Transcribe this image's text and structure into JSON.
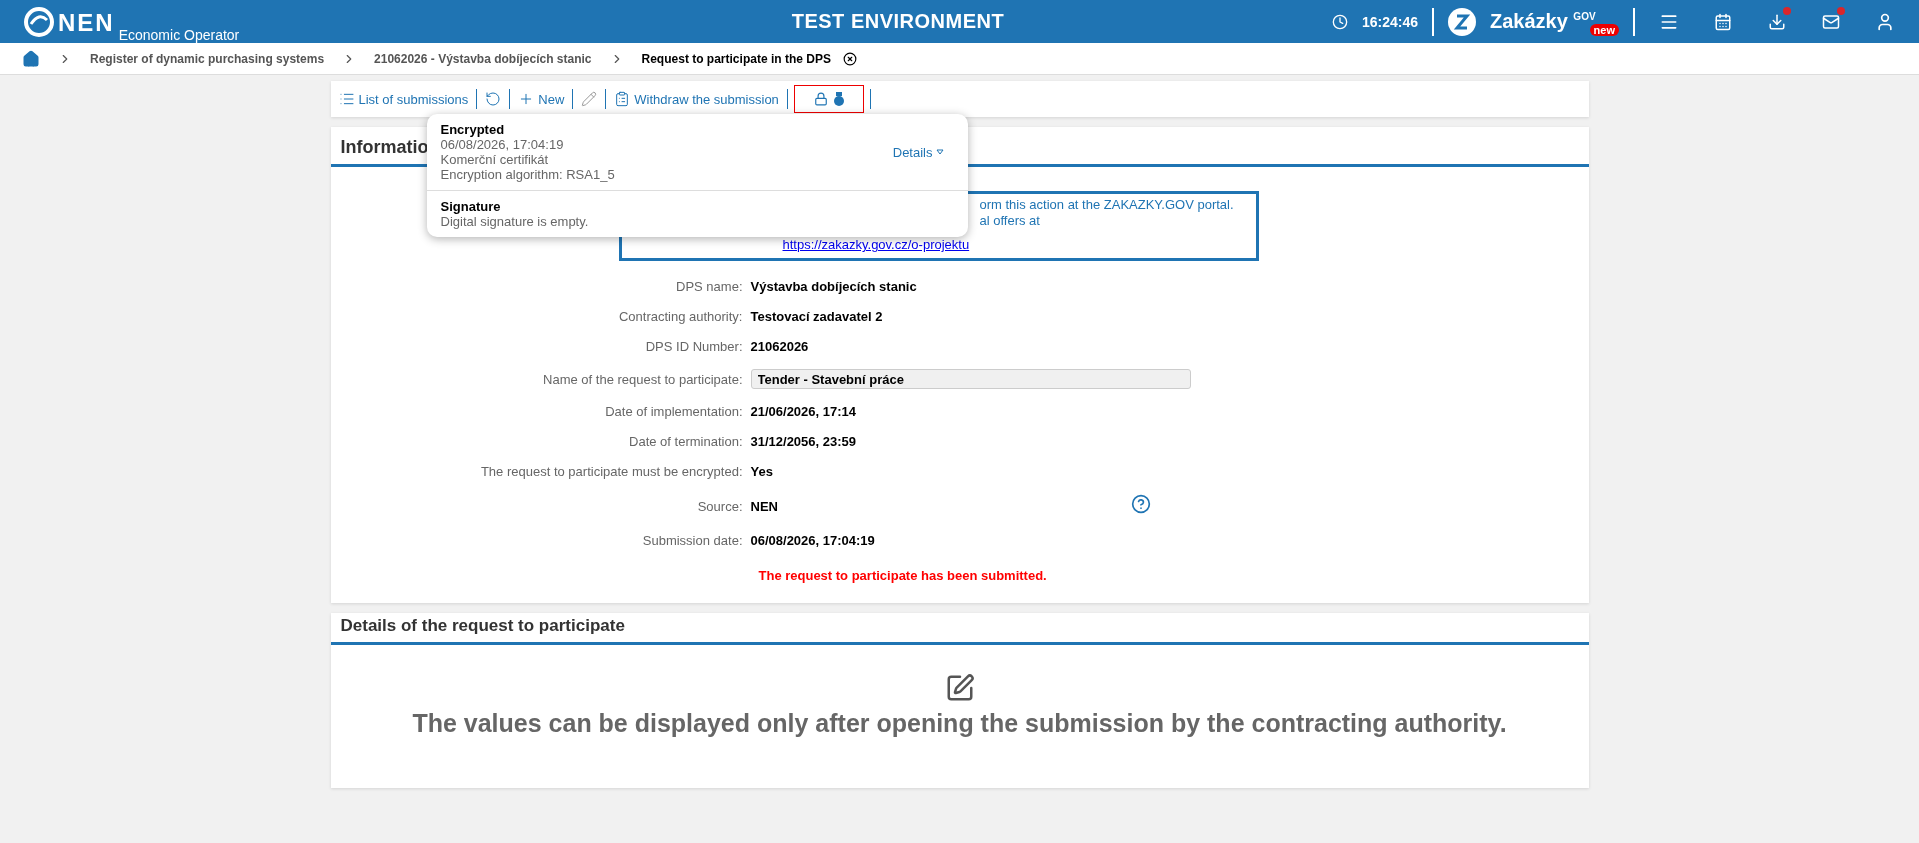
{
  "header": {
    "logo": "NEN",
    "subtitle": "Economic Operator",
    "environment": "TEST ENVIRONMENT",
    "time": "16:24:46",
    "portal": "Zakázky",
    "portal_sup": "GOV",
    "portal_badge": "new",
    "notifications": {
      "downloads": true,
      "messages": true
    }
  },
  "breadcrumb": [
    {
      "label": "Register of dynamic purchasing systems",
      "current": false
    },
    {
      "label": "21062026 - Výstavba dobíjecích stanic",
      "current": false
    },
    {
      "label": "Request to participate in the DPS",
      "current": true
    }
  ],
  "toolbar": {
    "items": [
      {
        "kind": "list",
        "label": "List of submissions",
        "disabled": false
      },
      {
        "kind": "refresh",
        "disabled": false
      },
      {
        "kind": "new",
        "label": "New",
        "disabled": false
      },
      {
        "kind": "edit",
        "disabled": true
      },
      {
        "kind": "withdraw",
        "label": "Withdraw the submission",
        "disabled": false
      }
    ],
    "security_highlighted": true
  },
  "popup": {
    "sections": [
      {
        "title": "Encrypted",
        "lines": [
          "06/08/2026, 17:04:19",
          "Komerční certifikát",
          "Encryption algorithm: RSA1_5"
        ],
        "action": "Details"
      },
      {
        "title": "Signature",
        "lines": [
          "Digital signature is empty."
        ]
      }
    ]
  },
  "information": {
    "title": "Informatio",
    "notice": [
      "orm this action at the ZAKAZKY.GOV portal.",
      "al offers at"
    ],
    "notice_link": "https://zakazky.gov.cz/o-projektu",
    "fields": [
      {
        "label": "DPS name:",
        "value": "Výstavba dobíjecích stanic",
        "kind": "text"
      },
      {
        "label": "Contracting authority:",
        "value": "Testovací zadavatel 2",
        "kind": "text"
      },
      {
        "label": "DPS ID Number:",
        "value": "21062026",
        "kind": "text"
      },
      {
        "label": "Name of the request to participate:",
        "value": "Tender - Stavební práce",
        "kind": "input"
      },
      {
        "label": "Date of implementation:",
        "value": "21/06/2026, 17:14",
        "kind": "text"
      },
      {
        "label": "Date of termination:",
        "value": "31/12/2056, 23:59",
        "kind": "text"
      },
      {
        "label": "The request to participate must be encrypted:",
        "value": "Yes",
        "kind": "text"
      },
      {
        "label": "Source:",
        "value": "NEN",
        "kind": "help"
      },
      {
        "label": "Submission date:",
        "value": "06/08/2026, 17:04:19",
        "kind": "text"
      }
    ],
    "status": "The request to participate has been submitted."
  },
  "details": {
    "title": "Details of the request to participate",
    "message": "The values can be displayed only after opening the submission by the contracting authority."
  }
}
